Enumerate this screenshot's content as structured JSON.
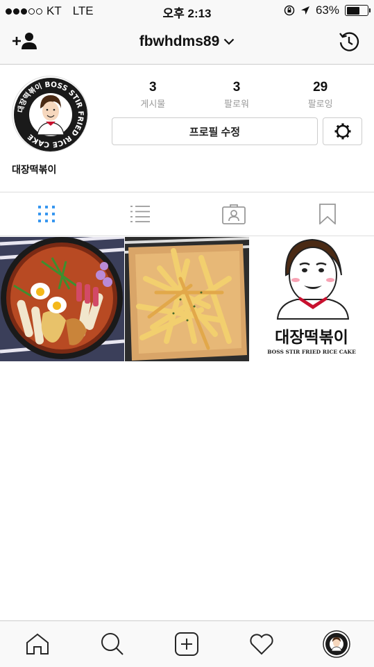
{
  "status_bar": {
    "carrier": "KT",
    "network": "LTE",
    "time": "오후 2:13",
    "battery_percent": "63%",
    "battery_level": 0.63
  },
  "header": {
    "username": "fbwhdms89",
    "add_user_icon": "add-user-icon",
    "history_icon": "history-icon",
    "dropdown_icon": "chevron-down-icon"
  },
  "profile": {
    "avatar_ring_text": "대장떡볶이 BOSS STIR FRIED RICE CAKE",
    "name": "대장떡볶이",
    "stats": [
      {
        "value": "3",
        "label": "게시물"
      },
      {
        "value": "3",
        "label": "팔로워"
      },
      {
        "value": "29",
        "label": "팔로잉"
      }
    ],
    "edit_button": "프로필 수정"
  },
  "tabs": [
    {
      "name": "grid-view",
      "active": true
    },
    {
      "name": "list-view",
      "active": false
    },
    {
      "name": "tagged",
      "active": false
    },
    {
      "name": "saved",
      "active": false
    }
  ],
  "posts": [
    {
      "kind": "photo",
      "subject": "tteokbokki pot"
    },
    {
      "kind": "photo",
      "subject": "french fries"
    },
    {
      "kind": "logo",
      "brand_ko": "대장떡볶이",
      "brand_en": "BOSS STIR FRIED RICE CAKE"
    }
  ],
  "bottom_nav": [
    "home-icon",
    "search-icon",
    "add-post-icon",
    "activity-heart-icon",
    "profile-avatar-icon"
  ],
  "colors": {
    "accent": "#3897f0",
    "chef_collar": "#c8102e",
    "icon": "#262626"
  }
}
